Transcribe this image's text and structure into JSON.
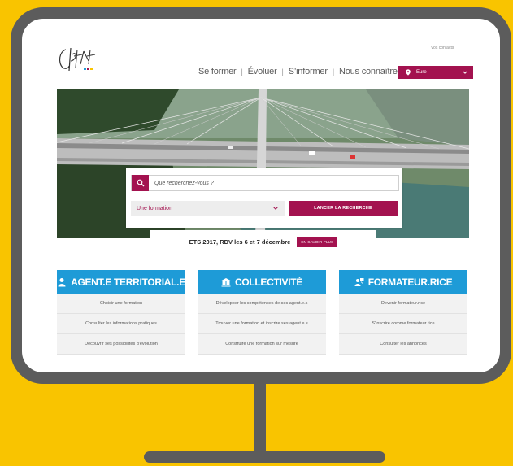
{
  "logo": {
    "text": "Cnfpt"
  },
  "header": {
    "contacts_link": "Vos contacts",
    "nav": [
      "Se former",
      "Évoluer",
      "S’informer",
      "Nous connaître"
    ],
    "region": "Eure"
  },
  "search": {
    "placeholder": "Que recherchez-vous ?",
    "type_value": "Une formation",
    "launch_label": "LANCER LA RECHERCHE"
  },
  "event": {
    "text": "ETS 2017, RDV les 6 et 7 décembre",
    "button": "EN SAVOIR PLUS"
  },
  "columns": [
    {
      "title": "AGENT.E TERRITORIAL.E",
      "icon": "person-icon",
      "items": [
        "Choisir une formation",
        "Consulter les informations pratiques",
        "Découvrir ses possibilités d'évolution"
      ]
    },
    {
      "title": "COLLECTIVITÉ",
      "icon": "building-icon",
      "items": [
        "Développer les compétences de ses agent.e.s",
        "Trouver une formation et inscrire ses agent.e.s",
        "Construire une formation sur mesure"
      ]
    },
    {
      "title": "FORMATEUR.RICE",
      "icon": "trainer-icon",
      "items": [
        "Devenir formateur.rice",
        "S'inscrire comme formateur.rice",
        "Consulter les annonces"
      ]
    }
  ],
  "colors": {
    "brand": "#A3124F",
    "accent": "#1E9BD7",
    "background": "#F9C400",
    "frame": "#5C5C5C"
  }
}
